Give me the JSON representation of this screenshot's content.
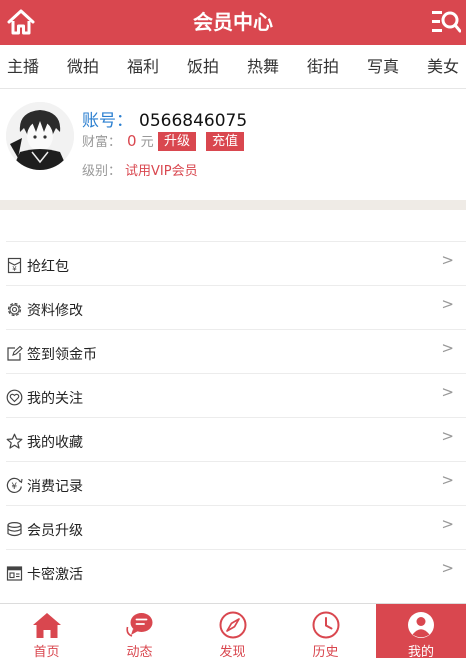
{
  "header": {
    "title": "会员中心"
  },
  "categories": [
    "主播",
    "微拍",
    "福利",
    "饭拍",
    "热舞",
    "街拍",
    "写真",
    "美女"
  ],
  "profile": {
    "account_label": "账号：",
    "account_value": "0566846075",
    "wealth_label": "财富：",
    "wealth_value": "0",
    "wealth_unit": "元",
    "upgrade_button": "升级",
    "recharge_button": "充值",
    "level_label": "级别：",
    "level_value": "试用VIP会员"
  },
  "menu": [
    {
      "label": "抢红包",
      "icon": "red-envelope-icon",
      "arrow": ">"
    },
    {
      "label": "资料修改",
      "icon": "gear-icon",
      "arrow": ">"
    },
    {
      "label": "签到领金币",
      "icon": "edit-icon",
      "arrow": ">"
    },
    {
      "label": "我的关注",
      "icon": "heart-icon",
      "arrow": ">"
    },
    {
      "label": "我的收藏",
      "icon": "star-icon",
      "arrow": ">"
    },
    {
      "label": "消费记录",
      "icon": "yen-icon",
      "arrow": ">"
    },
    {
      "label": "会员升级",
      "icon": "database-icon",
      "arrow": ">"
    },
    {
      "label": "卡密激活",
      "icon": "card-icon",
      "arrow": ">"
    }
  ],
  "tabs": [
    {
      "label": "首页",
      "icon": "home-icon"
    },
    {
      "label": "动态",
      "icon": "chat-icon"
    },
    {
      "label": "发现",
      "icon": "compass-icon"
    },
    {
      "label": "历史",
      "icon": "clock-icon"
    },
    {
      "label": "我的",
      "icon": "user-icon",
      "active": true
    }
  ],
  "colors": {
    "accent": "#d9474f",
    "link": "#2b7fd0"
  }
}
